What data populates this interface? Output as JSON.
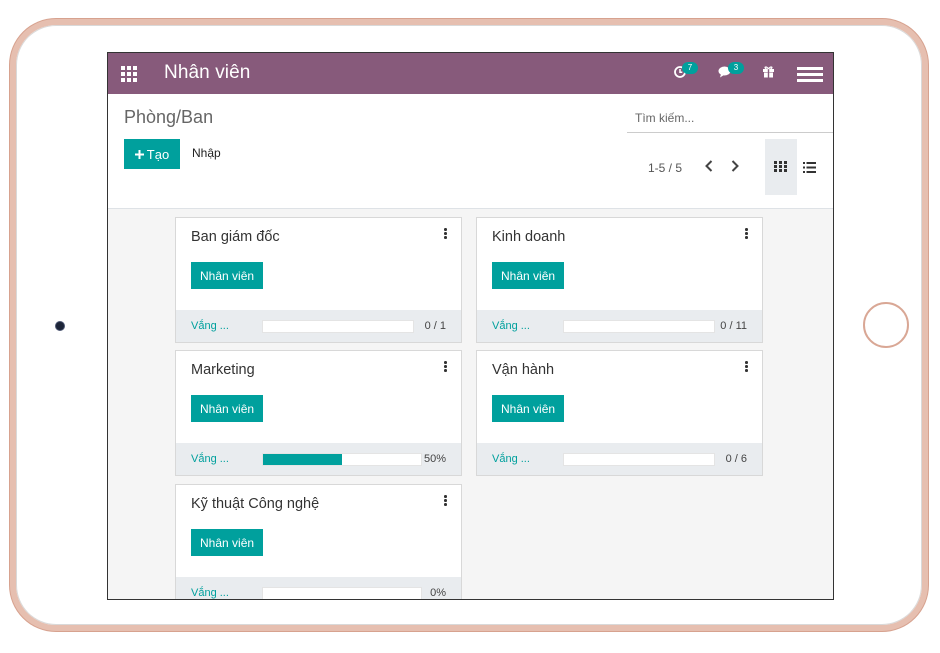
{
  "navbar": {
    "title": "Nhân viên",
    "activity_badge": "7",
    "messages_badge": "3"
  },
  "control_panel": {
    "breadcrumb": "Phòng/Ban",
    "search_placeholder": "Tìm kiếm...",
    "create_label": "Tạo",
    "import_label": "Nhập",
    "pager_text": "1-5 / 5"
  },
  "cards": [
    {
      "title": "Ban giám đốc",
      "button": "Nhân viên",
      "footer_label": "Vắng ...",
      "progress_text": "0 / 1",
      "progress_fraction": 0
    },
    {
      "title": "Kinh doanh",
      "button": "Nhân viên",
      "footer_label": "Vắng ...",
      "progress_text": "0 / 11",
      "progress_fraction": 0
    },
    {
      "title": "Marketing",
      "button": "Nhân viên",
      "footer_label": "Vắng ...",
      "progress_text": "50%",
      "progress_fraction": 0.5
    },
    {
      "title": "Vận hành",
      "button": "Nhân viên",
      "footer_label": "Vắng ...",
      "progress_text": "0 / 6",
      "progress_fraction": 0
    },
    {
      "title": "Kỹ thuật Công nghệ",
      "button": "Nhân viên",
      "footer_label": "Vắng ...",
      "progress_text": "0%",
      "progress_fraction": 0
    }
  ],
  "colors": {
    "navbar": "#875a7b",
    "accent": "#00a09d"
  },
  "icons": [
    "apps-grid-icon",
    "activity-clock-icon",
    "chat-bubble-icon",
    "gift-icon",
    "hamburger-menu-icon",
    "plus-icon",
    "chevron-left-icon",
    "chevron-right-icon",
    "kanban-view-icon",
    "list-view-icon",
    "kebab-menu-icon"
  ]
}
